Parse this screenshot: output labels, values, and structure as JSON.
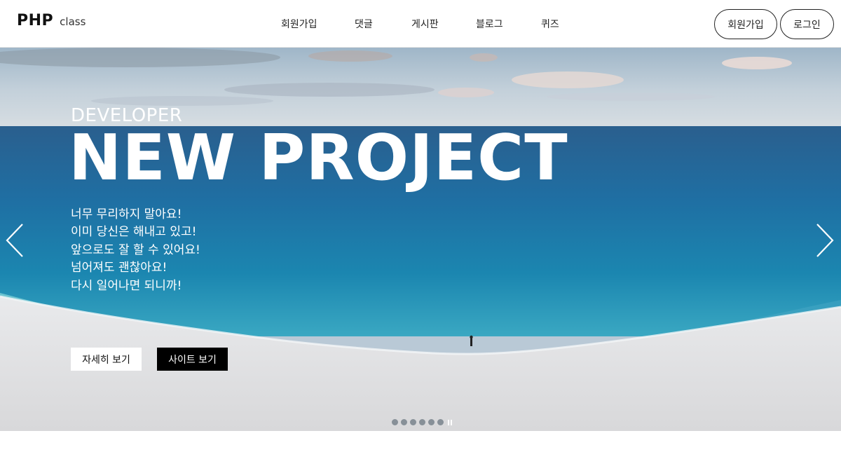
{
  "header": {
    "logo_main": "PHP",
    "logo_sub": "class",
    "nav": [
      "회원가입",
      "댓글",
      "게시판",
      "블로그",
      "퀴즈"
    ],
    "signup_label": "회원가입",
    "login_label": "로그인"
  },
  "hero": {
    "eyebrow": "DEVELOPER",
    "headline": "NEW PROJECT",
    "lines": [
      "너무 무리하지 말아요!",
      "이미 당신은 해내고 있고!",
      "앞으로도 잘 할 수 있어요!",
      "넘어져도 괜찮아요!",
      "다시 일어나면 되니까!"
    ],
    "more_label": "자세히 보기",
    "site_label": "사이트 보기",
    "slide_count": 6,
    "prev_icon": "chevron-left-icon",
    "next_icon": "chevron-right-icon",
    "pause_icon": "pause-icon"
  }
}
